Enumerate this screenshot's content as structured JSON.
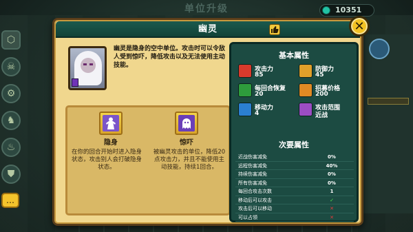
{
  "background": {
    "screen_title": "单位升级",
    "coins": "10351"
  },
  "modal": {
    "title": "幽灵",
    "description": "幽灵是隐身的空中单位。攻击时可以令敌人受到惊吓，降低攻击以及无法使用主动技能。",
    "abilities": [
      {
        "name": "隐身",
        "icon": "stealth-icon",
        "text": "在你的回合开始时进入隐身状态，攻击别人会打破隐身状态。"
      },
      {
        "name": "惊吓",
        "icon": "ghost-scare-icon",
        "text": "被幽灵攻击的单位，降低20点攻击力，并且不能使用主动技能，持续1回合。"
      }
    ],
    "basic_title": "基本属性",
    "basic_stats": [
      {
        "label": "攻击力",
        "value": "85",
        "icon": "attack-icon",
        "color": "#d83a2c"
      },
      {
        "label": "防御力",
        "value": "45",
        "icon": "defense-icon",
        "color": "#e0a02a"
      },
      {
        "label": "每回合恢复",
        "value": "20",
        "icon": "heal-icon",
        "color": "#2e9c3c"
      },
      {
        "label": "招募价格",
        "value": "200",
        "icon": "cost-icon",
        "color": "#e08a24"
      },
      {
        "label": "移动力",
        "value": "4",
        "icon": "move-icon",
        "color": "#2b7fd1"
      },
      {
        "label": "攻击范围",
        "value": "近战",
        "icon": "range-icon",
        "color": "#9b4dc4"
      }
    ],
    "minor_title": "次要属性",
    "minor_stats": [
      {
        "label": "近战伤害减免",
        "value": "0%"
      },
      {
        "label": "远程伤害减免",
        "value": "40%"
      },
      {
        "label": "持续伤害减免",
        "value": "0%"
      },
      {
        "label": "所有伤害减免",
        "value": "0%"
      },
      {
        "label": "每回合攻击次数",
        "value": "1"
      },
      {
        "label": "移动后可以攻击",
        "value": "✓",
        "kind": "check"
      },
      {
        "label": "攻击后可以移动",
        "value": "✕",
        "kind": "cross"
      },
      {
        "label": "可以占领",
        "value": "✕",
        "kind": "cross"
      }
    ]
  }
}
